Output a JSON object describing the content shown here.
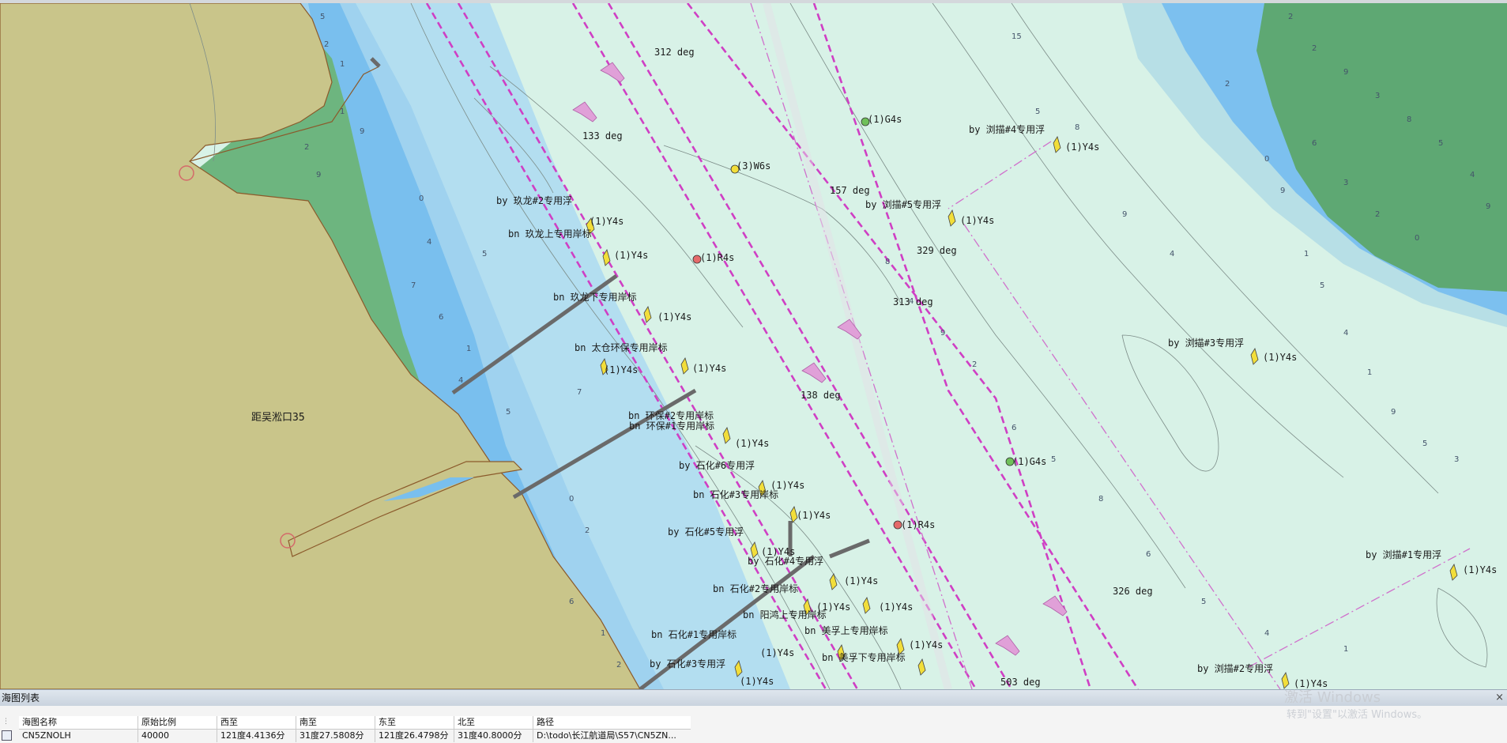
{
  "map": {
    "region_label": "距吴淞口35",
    "course_labels": [
      "312 deg",
      "133 deg",
      "157 deg",
      "329 deg",
      "313 deg",
      "138 deg",
      "326 deg",
      "503 deg"
    ],
    "features": [
      {
        "name": "by 玖龙#2专用浮"
      },
      {
        "name": "bn 玖龙上专用岸标"
      },
      {
        "name": "bn 玖龙下专用岸标"
      },
      {
        "name": "bn 太仓环保专用岸标"
      },
      {
        "name": "bn 环保#2专用岸标"
      },
      {
        "name": "bn 环保#1专用岸标"
      },
      {
        "name": "by 石化#6专用浮"
      },
      {
        "name": "bn 石化#3专用岸标"
      },
      {
        "name": "by 石化#5专用浮"
      },
      {
        "name": "by 石化#4专用浮"
      },
      {
        "name": "bn 石化#2专用岸标"
      },
      {
        "name": "bn 阳鸿上专用岸标"
      },
      {
        "name": "bn 美孚上专用岸标"
      },
      {
        "name": "bn 石化#1专用岸标"
      },
      {
        "name": "bn 美孚下专用岸标"
      },
      {
        "name": "by 石化#3专用浮"
      },
      {
        "name": "by 浏描#5专用浮"
      },
      {
        "name": "by 浏描#4专用浮"
      },
      {
        "name": "by 浏描#3专用浮"
      },
      {
        "name": "by 浏描#1专用浮"
      },
      {
        "name": "by 浏描#2专用浮"
      }
    ],
    "lights": [
      "(1)G4s",
      "(3)W6s",
      "(1)R4s",
      "(1)Y4s",
      "(1)G4s",
      "(1)R4s"
    ],
    "colors": {
      "land": "#c9c58a",
      "shallow_green": "#74b47e",
      "deep_blue": "#79bfee",
      "mid_blue": "#b3dcf0",
      "light_green": "#d7f2e6",
      "channel": "#c838c0"
    }
  },
  "panel": {
    "title": "海图列表",
    "close": "×",
    "columns": [
      "海图名称",
      "原始比例",
      "西至",
      "南至",
      "东至",
      "北至",
      "路径"
    ],
    "rows": [
      [
        "CN5ZNOLH",
        "40000",
        "121度4.4136分",
        "31度27.5808分",
        "121度26.4798分",
        "31度40.8000分",
        "D:\\todo\\长江航道局\\S57\\CN5ZN..."
      ]
    ]
  },
  "watermark": {
    "line1": "激活 Windows",
    "line2": "转到\"设置\"以激活 Windows。"
  }
}
